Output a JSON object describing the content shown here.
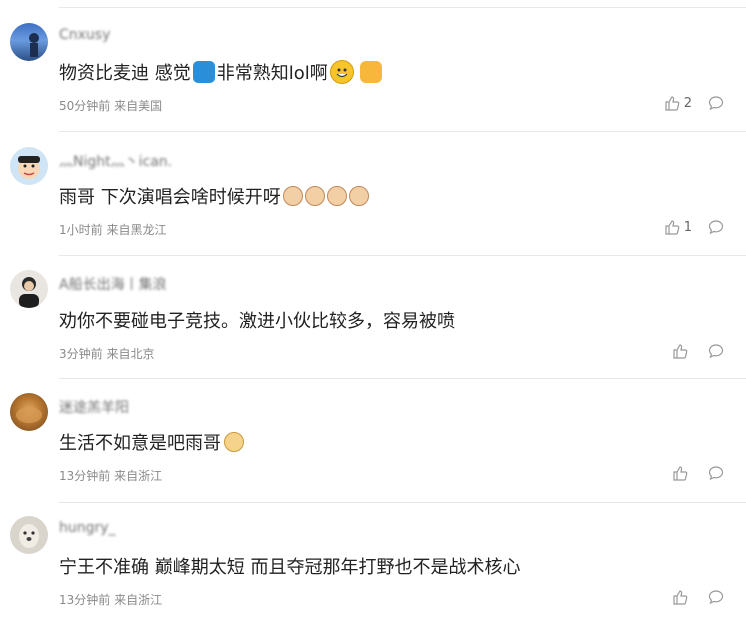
{
  "comments": [
    {
      "username": "Cnxusy",
      "text": "物资比麦迪 感觉",
      "text_after": "非常熟知lol啊",
      "emojis_inline": [
        "ok-hand-emoji"
      ],
      "emojis_end": [
        "grin-emoji",
        "wave-emoji"
      ],
      "meta": "50分钟前 来自美国",
      "likes": "2"
    },
    {
      "username": "灬Night灬丶ican.",
      "text": "雨哥 下次演唱会啥时候开呀",
      "emojis_end": [
        "cat-face-emoji",
        "cat-face-emoji",
        "cat-face-emoji",
        "cat-face-emoji"
      ],
      "meta": "1小时前 来自黑龙江",
      "likes": "1"
    },
    {
      "username": "A船长出海丨集浪",
      "text": "劝你不要碰电子竞技。激进小伙比较多，容易被喷",
      "meta": "3分钟前 来自北京",
      "likes": ""
    },
    {
      "username": "迷途羔羊阳",
      "text": "生活不如意是吧雨哥",
      "emojis_end": [
        "doge-emoji"
      ],
      "meta": "13分钟前 来自浙江",
      "likes": ""
    },
    {
      "username": "hungry_",
      "text": "宁王不准确 巅峰期太短 而且夺冠那年打野也不是战术核心",
      "meta": "13分钟前 来自浙江",
      "likes": ""
    }
  ],
  "colors": {
    "text": "#222222",
    "meta": "#8a8a8a",
    "separator": "#e8e8e8",
    "icon": "#999999"
  }
}
